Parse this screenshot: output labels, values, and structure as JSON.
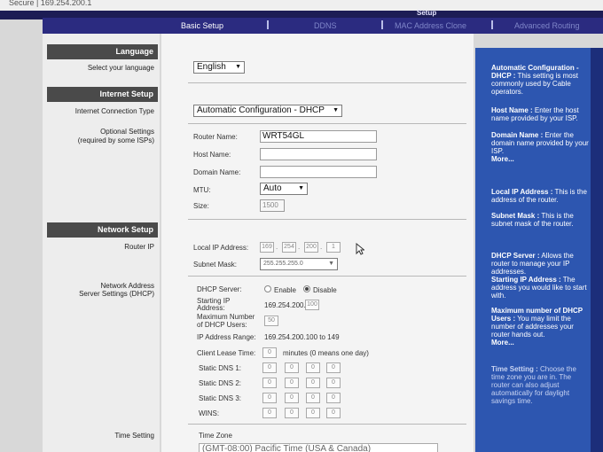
{
  "browser": {
    "address": "Secure | 169.254.200.1"
  },
  "header": {
    "caption": "Setup"
  },
  "nav": {
    "tabs": [
      "Basic Setup",
      "DDNS",
      "MAC Address Clone",
      "Advanced Routing"
    ],
    "active": "Basic Setup"
  },
  "sections": {
    "language": "Language",
    "internet": "Internet Setup",
    "network": "Network Setup"
  },
  "left_labels": {
    "select_language": "Select your language",
    "connection_type": "Internet Connection Type",
    "optional": "Optional Settings",
    "optional_sub": "(required by some ISPs)",
    "router_ip": "Router IP",
    "dhcp_1": "Network Address",
    "dhcp_2": "Server Settings (DHCP)",
    "time": "Time Setting"
  },
  "language": {
    "value": "English"
  },
  "internet": {
    "connection_type": "Automatic Configuration - DHCP",
    "router_name_label": "Router Name:",
    "router_name": "WRT54GL",
    "host_name_label": "Host Name:",
    "host_name": "",
    "domain_name_label": "Domain Name:",
    "domain_name": "",
    "mtu_label": "MTU:",
    "mtu": "Auto",
    "size_label": "Size:",
    "size": "1500"
  },
  "router_ip": {
    "local_ip_label": "Local IP Address:",
    "local_ip": [
      "169",
      "254",
      "200",
      "1"
    ],
    "subnet_label": "Subnet Mask:",
    "subnet": "255.255.255.0"
  },
  "dhcp": {
    "server_label": "DHCP Server:",
    "enable": "Enable",
    "disable": "Disable",
    "start_ip_label_1": "Starting IP",
    "start_ip_label_2": "Address:",
    "start_ip_prefix": "169.254.200.",
    "start_ip_last": "100",
    "max_users_label_1": "Maximum Number",
    "max_users_label_2": "of  DHCP Users:",
    "max_users": "50",
    "range_label": "IP Address Range:",
    "range": "169.254.200.100 to 149",
    "lease_label": "Client Lease Time:",
    "lease": "0",
    "lease_note": "minutes (0 means one day)",
    "dns1_label": "Static DNS 1:",
    "dns2_label": "Static DNS 2:",
    "dns3_label": "Static DNS 3:",
    "wins_label": "WINS:",
    "octet": "0"
  },
  "time": {
    "zone_label": "Time Zone",
    "zone": "(GMT-08:00) Pacific Time (USA & Canada)"
  },
  "help": {
    "p1_title": "Automatic Configuration - DHCP :",
    "p1_body": "This setting is most commonly used by Cable operators.",
    "p2_title": "Host Name :",
    "p2_body": "Enter the host name provided by your ISP.",
    "p3_title": "Domain Name :",
    "p3_body": "Enter the domain name provided by your ISP.",
    "more": "More...",
    "p4_title": "Local IP Address :",
    "p4_body": "This is the address of the router.",
    "p5_title": "Subnet Mask :",
    "p5_body": "This is the subnet mask of the router.",
    "p6_title": "DHCP Server :",
    "p6_body": "Allows the router to manage your IP addresses.",
    "p7_title": "Starting IP Address :",
    "p7_body": "The address you would like to start with.",
    "p8_title": "Maximum number of DHCP Users :",
    "p8_body": "You may limit the number of addresses your router hands out.",
    "p9_title": "Time Setting :",
    "p9_body": "Choose the time zone you are in. The router can also adjust automatically for daylight savings time."
  },
  "colors": {
    "nav": "#2b2b80",
    "help_panel": "#2d56b0",
    "section_bar": "#4a4a4a"
  }
}
